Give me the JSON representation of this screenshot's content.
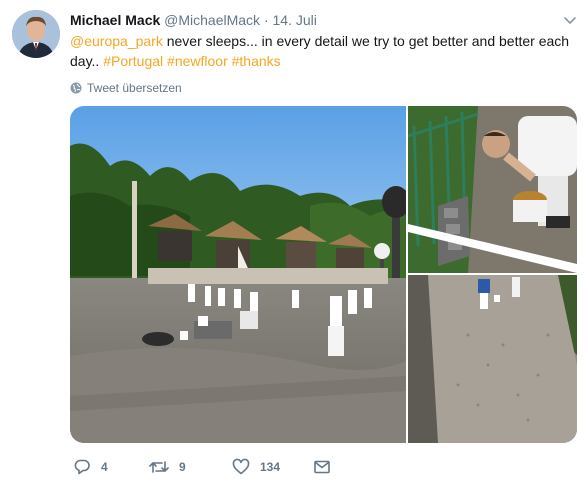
{
  "author": {
    "name": "Michael Mack",
    "handle": "@MichaelMack",
    "separator": "·",
    "date": "14. Juli"
  },
  "tweet": {
    "mention": "@europa_park",
    "text_part1": " never sleeps... in every detail we try to get better and better each day.. ",
    "hashtag1": "#Portugal",
    "hashtag2": "#newfloor",
    "hashtag3": "#thanks"
  },
  "translate_label": "Tweet übersetzen",
  "actions": {
    "reply_count": "4",
    "retweet_count": "9",
    "like_count": "134"
  },
  "icons": {
    "caret": "chevron-down-icon",
    "translate": "globe-icon",
    "reply": "reply-icon",
    "retweet": "retweet-icon",
    "like": "heart-icon",
    "dm": "envelope-icon"
  },
  "colors": {
    "link": "#f5a623",
    "secondary_text": "#657786",
    "primary_text": "#14171a"
  }
}
